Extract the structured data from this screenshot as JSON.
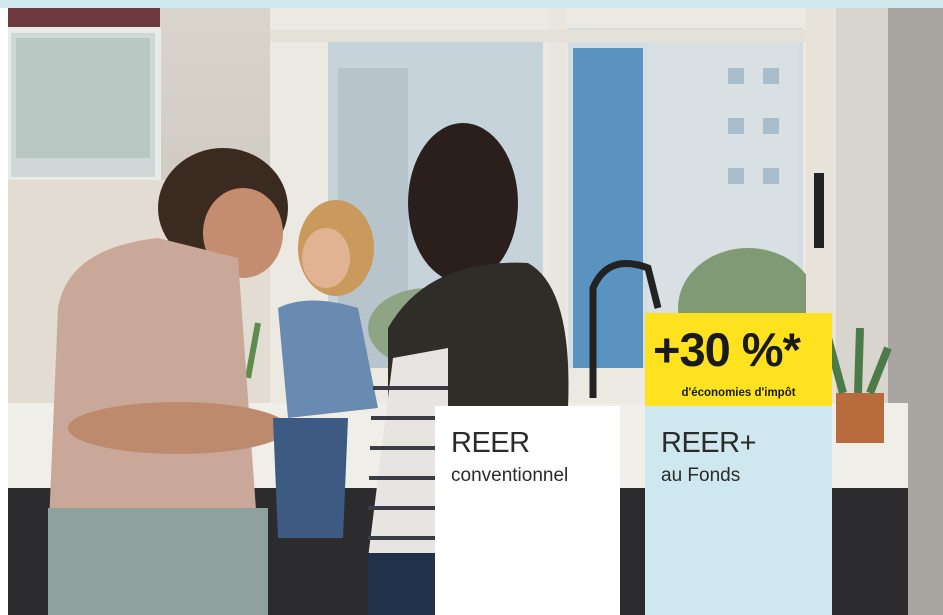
{
  "promo": {
    "badge_main": "+30 %*",
    "badge_sub": "d'économies d'impôt"
  },
  "cards": {
    "conventional": {
      "title": "REER",
      "subtitle": "conventionnel"
    },
    "fonds": {
      "title": "REER+",
      "subtitle": "au Fonds"
    }
  },
  "colors": {
    "badge_bg": "#ffe21f",
    "fonds_card_bg": "#cfe7ef",
    "conventional_card_bg": "#ffffff",
    "text": "#2b2b2b"
  }
}
